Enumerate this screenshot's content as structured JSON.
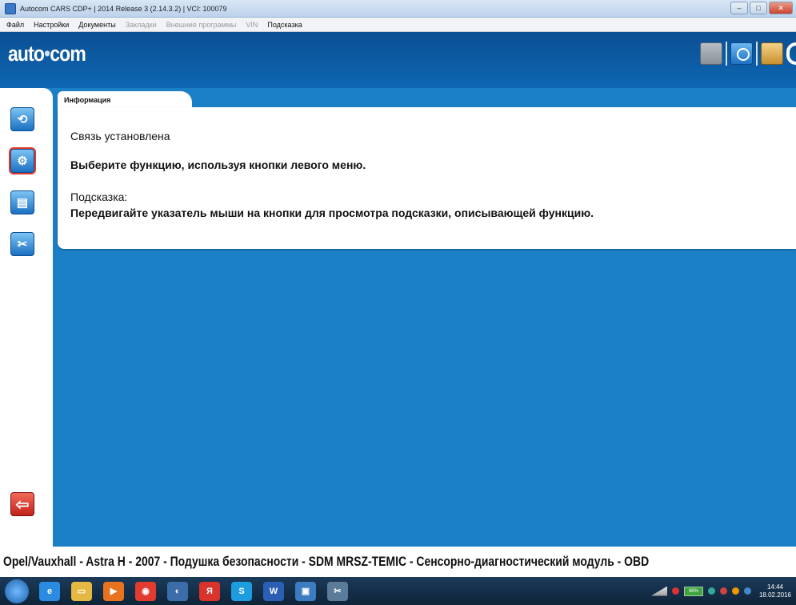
{
  "window": {
    "title": "Autocom CARS CDP+ | 2014 Release 3 (2.14.3.2) | VCI: 100079",
    "controls": [
      "–",
      "□",
      "✕"
    ]
  },
  "menu": {
    "items": [
      {
        "label": "Файл",
        "enabled": true
      },
      {
        "label": "Настройки",
        "enabled": true
      },
      {
        "label": "Документы",
        "enabled": true
      },
      {
        "label": "Закладки",
        "enabled": false
      },
      {
        "label": "Внешние программы",
        "enabled": false
      },
      {
        "label": "VIN",
        "enabled": false
      },
      {
        "label": "Подсказка",
        "enabled": true
      }
    ]
  },
  "header": {
    "logo_left": "auto",
    "logo_dot": "•",
    "logo_right": "com"
  },
  "left_toolbar": {
    "buttons": [
      {
        "icon": "connection-icon",
        "glyph": "⟲"
      },
      {
        "icon": "diagnostics-icon",
        "glyph": "⚙"
      },
      {
        "icon": "report-icon",
        "glyph": "▤"
      },
      {
        "icon": "tools-icon",
        "glyph": "✂"
      }
    ],
    "back_glyph": "⇦"
  },
  "info_panel": {
    "tab_label": "Информация",
    "line1": "Связь установлена",
    "line2": "Выберите функцию, используя кнопки левого меню.",
    "hint_title": "Подсказка:",
    "hint_text": "Передвигайте указатель мыши на кнопки для просмотра подсказки, описывающей функцию."
  },
  "status": {
    "vehicle_line": "Opel/Vauxhall - Astra H - 2007 - Подушка безопасности - SDM MRSZ-TEMIC - Сенсорно-диагностический модуль - OBD"
  },
  "taskbar": {
    "apps": [
      {
        "name": "ie-icon",
        "color": "#2a8be0",
        "glyph": "e"
      },
      {
        "name": "explorer-icon",
        "color": "#e5b842",
        "glyph": "▭"
      },
      {
        "name": "media-player-icon",
        "color": "#e8731f",
        "glyph": "▶"
      },
      {
        "name": "chrome-icon",
        "color": "#e23b2f",
        "glyph": "◉"
      },
      {
        "name": "speaker-icon",
        "color": "#3b6ea8",
        "glyph": "◐"
      },
      {
        "name": "yandex-icon",
        "color": "#d9332b",
        "glyph": "Я"
      },
      {
        "name": "skype-icon",
        "color": "#1e9ce0",
        "glyph": "S"
      },
      {
        "name": "word-icon",
        "color": "#2b5fb4",
        "glyph": "W"
      },
      {
        "name": "car-app-icon",
        "color": "#3c7cc0",
        "glyph": "▣"
      },
      {
        "name": "autocom-icon",
        "color": "#5a7c9a",
        "glyph": "✂"
      }
    ],
    "battery_text": "96%",
    "time": "14:44",
    "date": "18.02.2016"
  }
}
